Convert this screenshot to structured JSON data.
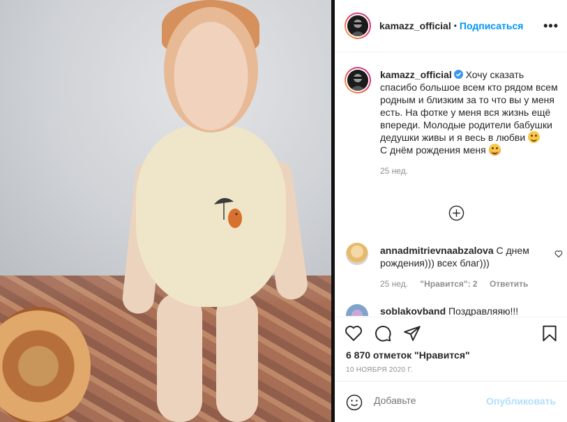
{
  "header": {
    "username": "kamazz_official",
    "separator": "•",
    "follow_label": "Подписаться",
    "more_label": "•••"
  },
  "caption": {
    "username": "kamazz_official",
    "text_1": "Хочу сказать спасибо большое всем кто рядом всем родным и близким за то что вы у меня есть. На фотке у меня вся жизнь ещё впереди. Молодые родители бабушки дедушки живы и я весь в любви",
    "text_2": "С днём рождения меня",
    "time": "25 нед."
  },
  "comments": [
    {
      "username": "annadmitrievnaabzalova",
      "text": "С днем рождения))) всех благ)))",
      "time": "25 нед.",
      "likes_label": "\"Нравится\": 2",
      "reply_label": "Ответить"
    },
    {
      "username": "soblakovband",
      "text": "Поздравляяю!!!"
    }
  ],
  "actions": {
    "likes": "6 870 отметок \"Нравится\"",
    "date": "10 ноября 2020 г."
  },
  "composer": {
    "placeholder": "Добавьте",
    "publish_label": "Опубликовать"
  },
  "colors": {
    "accent": "#0095f6",
    "publish_disabled": "#b2dffc",
    "muted": "#8e8e8e",
    "text": "#262626"
  },
  "icons": {
    "like": "heart-icon",
    "comment": "comment-icon",
    "share": "share-icon",
    "save": "bookmark-icon",
    "emoji": "smile-icon",
    "load_more": "plus-circle-icon",
    "verified": "verified-icon"
  }
}
